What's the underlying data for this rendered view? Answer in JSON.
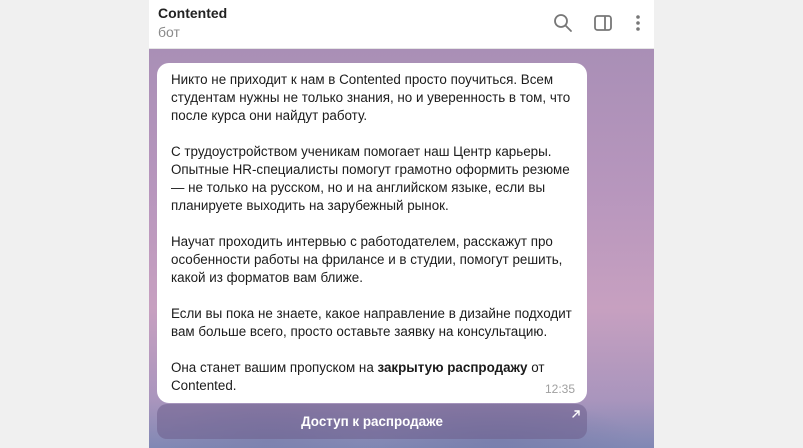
{
  "header": {
    "title": "Contented",
    "subtitle": "бот",
    "icons": [
      "search-icon",
      "sidebar-toggle-icon",
      "more-vertical-icon"
    ]
  },
  "message": {
    "p1": "Никто не приходит к нам в Contented просто поучиться. Всем студентам нужны не только знания, но и уверенность в том, что после курса они найдут работу.",
    "p2": "С трудоустройством ученикам помогает наш Центр карьеры. Опытные HR-специалисты помогут грамотно оформить резюме — не только на русском, но и на английском языке, если вы планируете выходить на зарубежный рынок.",
    "p3": "Научат проходить интервью с работодателем, расскажут про особенности работы на фрилансе и в студии, помогут решить, какой из форматов вам ближе.",
    "p4": "Если вы пока не знаете, какое направление в дизайне подходит вам больше всего, просто оставьте заявку на консультацию.",
    "p5_start": "Она станет вашим пропуском на ",
    "p5_bold": "закрытую распродажу",
    "p5_end": " от Contented.",
    "time": "12:35"
  },
  "inline_button": {
    "label": "Доступ к распродаже",
    "icon": "external-link-arrow-icon"
  }
}
